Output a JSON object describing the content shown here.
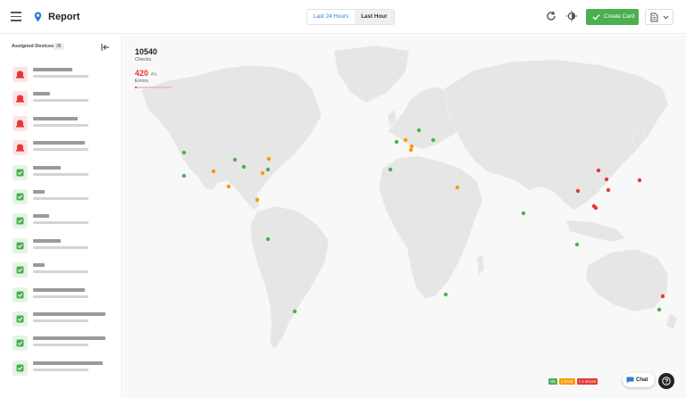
{
  "header": {
    "title": "Report",
    "range_options": [
      "Last 24 Hours",
      "Last Hour"
    ],
    "create_label": "Create Card"
  },
  "sidebar": {
    "heading": "Assigned Devices",
    "count": "36",
    "devices": [
      {
        "status": "error",
        "name_len": 44
      },
      {
        "status": "error",
        "name_len": 19
      },
      {
        "status": "error",
        "name_len": 50
      },
      {
        "status": "error",
        "name_len": 58
      },
      {
        "status": "ok",
        "name_len": 31
      },
      {
        "status": "ok",
        "name_len": 13
      },
      {
        "status": "ok",
        "name_len": 18
      },
      {
        "status": "ok",
        "name_len": 31
      },
      {
        "status": "ok",
        "name_len": 13
      },
      {
        "status": "ok",
        "name_len": 58
      },
      {
        "status": "ok",
        "name_len": 81
      },
      {
        "status": "ok",
        "name_len": 81
      },
      {
        "status": "ok",
        "name_len": 78
      }
    ]
  },
  "stats": {
    "checks": "10540",
    "checks_label": "Checks",
    "errors": "420",
    "errors_pct": "4%",
    "errors_label": "Errors",
    "errors_fraction": 0.04
  },
  "legend": {
    "ok": "Ok",
    "one_error": "1 Error",
    "multi_error": "> 1 Errors"
  },
  "colors": {
    "ok": "#4caf50",
    "one_error": "#ff9800",
    "multi_error": "#e53935",
    "accent": "#2f7cd6",
    "land": "#e6e6e6"
  },
  "chat_label": "Chat"
}
